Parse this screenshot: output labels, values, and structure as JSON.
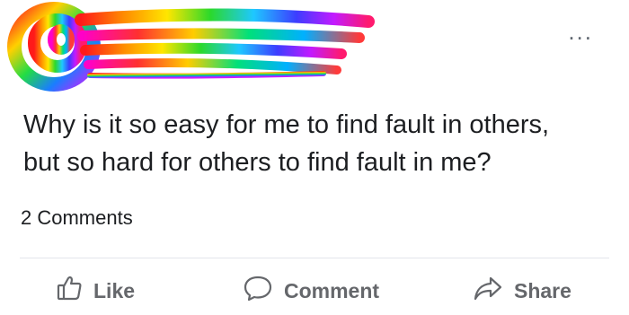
{
  "post": {
    "menu_glyph": "...",
    "text_line1": "Why is it so easy for me to find fault in others,",
    "text_line2": "but so hard for others to find fault in me?",
    "comments_count": "2 Comments"
  },
  "actions": {
    "like_label": "Like",
    "comment_label": "Comment",
    "share_label": "Share"
  },
  "icons": {
    "like": "thumbs-up-icon",
    "comment": "speech-bubble-icon",
    "share": "share-arrow-icon",
    "menu": "more-options-icon"
  },
  "colors": {
    "action_text": "#65676b",
    "post_text": "#1c1e21",
    "divider": "#e4e6eb"
  }
}
